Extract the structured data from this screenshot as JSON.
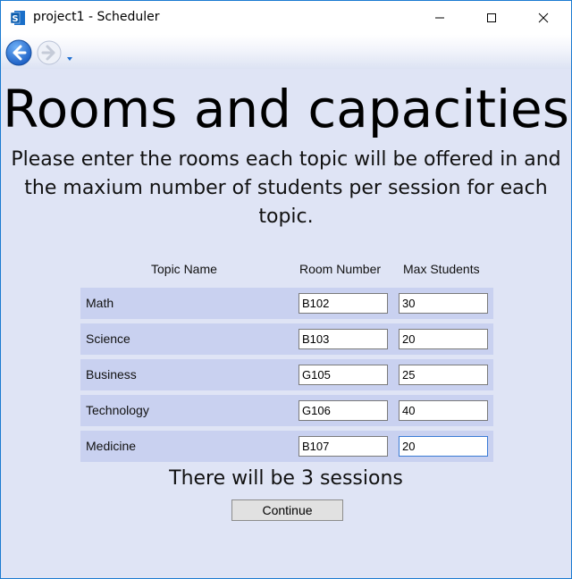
{
  "window": {
    "title": "project1 - Scheduler"
  },
  "page": {
    "heading": "Rooms and capacities",
    "instructions": "Please enter the rooms each topic will be offered in and the maxium number of students per session for each topic."
  },
  "table": {
    "headers": {
      "topic": "Topic Name",
      "room": "Room Number",
      "max": "Max Students"
    },
    "rows": [
      {
        "topic": "Math",
        "room": "B102",
        "max": "30"
      },
      {
        "topic": "Science",
        "room": "B103",
        "max": "20"
      },
      {
        "topic": "Business",
        "room": "G105",
        "max": "25"
      },
      {
        "topic": "Technology",
        "room": "G106",
        "max": "40"
      },
      {
        "topic": "Medicine",
        "room": "B107",
        "max": "20"
      }
    ]
  },
  "summary": {
    "sessions_text": "There will be 3 sessions"
  },
  "buttons": {
    "continue_label": "Continue"
  },
  "icons": {
    "app": "sharepoint-s-icon",
    "back": "back-arrow-icon",
    "forward": "forward-arrow-icon",
    "history": "dropdown-caret-icon"
  },
  "colors": {
    "window_border": "#1b7bd1",
    "background": "#dfe4f5",
    "row_background": "#c9d1f0",
    "nav_accent": "#1c6dd0"
  }
}
